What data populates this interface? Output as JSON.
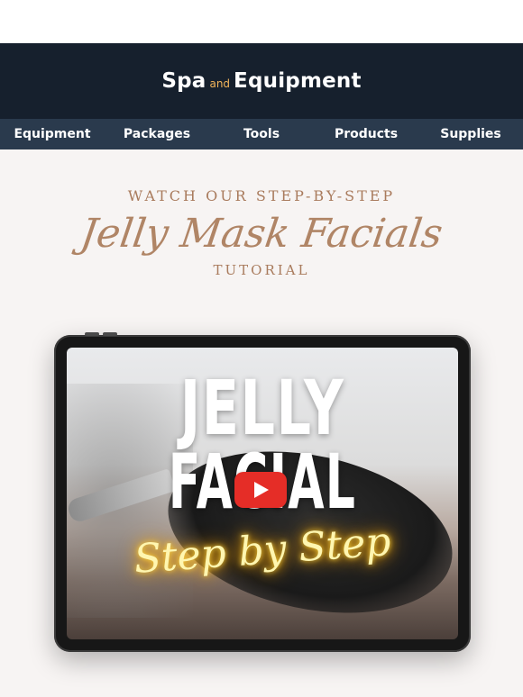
{
  "brand": {
    "left": "Spa",
    "connector": "and",
    "right": "Equipment",
    "accent_color": "#f2b45a"
  },
  "nav": {
    "items": [
      {
        "label": "Equipment"
      },
      {
        "label": "Packages"
      },
      {
        "label": "Tools"
      },
      {
        "label": "Products"
      },
      {
        "label": "Supplies"
      }
    ]
  },
  "hero": {
    "eyebrow": "WATCH OUR STEP-BY-STEP",
    "script_title": "Jelly Mask Facials",
    "subline": "TUTORIAL"
  },
  "video": {
    "line1": "JELLY",
    "line2": "FACIAL",
    "neon_text": "Step by Step",
    "play_icon": "play-icon",
    "play_color": "#e52d27"
  }
}
